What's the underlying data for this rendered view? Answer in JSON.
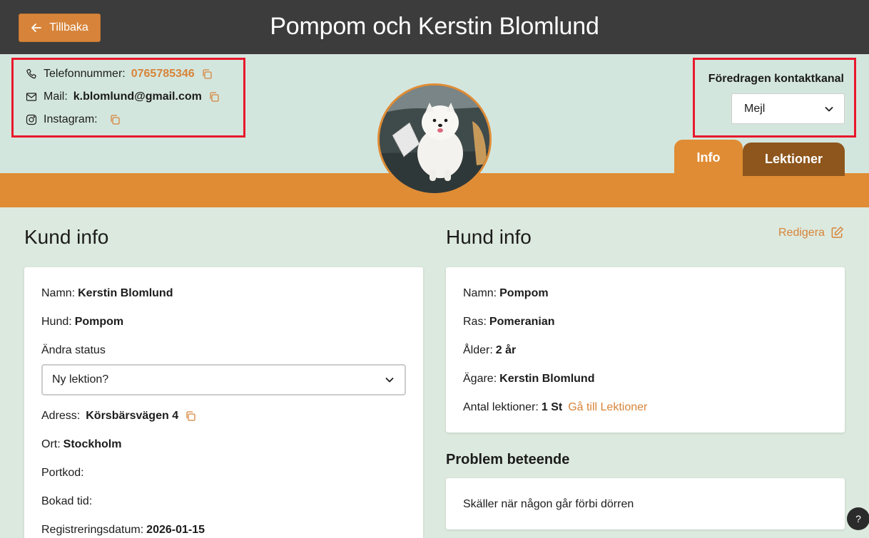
{
  "header": {
    "back_label": "Tillbaka",
    "title": "Pompom och Kerstin Blomlund"
  },
  "contact": {
    "phone_label": "Telefonnummer:",
    "phone_value": "0765785346",
    "mail_label": "Mail:",
    "mail_value": "k.blomlund@gmail.com",
    "instagram_label": "Instagram:"
  },
  "preferred_contact": {
    "label": "Föredragen kontaktkanal",
    "selected": "Mejl"
  },
  "tabs": [
    {
      "label": "Info"
    },
    {
      "label": "Lektioner"
    }
  ],
  "customer": {
    "section_title": "Kund info",
    "name_label": "Namn:",
    "name_value": "Kerstin Blomlund",
    "dog_label": "Hund:",
    "dog_value": "Pompom",
    "status_label": "Ändra status",
    "status_selected": "Ny lektion?",
    "address_label": "Adress:",
    "address_value": "Körsbärsvägen 4",
    "city_label": "Ort:",
    "city_value": "Stockholm",
    "doorcode_label": "Portkod:",
    "booked_label": "Bokad tid:",
    "registered_label": "Registreringsdatum:",
    "registered_value": "2026-01-15"
  },
  "dog": {
    "section_title": "Hund info",
    "edit_label": "Redigera",
    "name_label": "Namn:",
    "name_value": "Pompom",
    "breed_label": "Ras:",
    "breed_value": "Pomeranian",
    "age_label": "Ålder:",
    "age_value": "2 år",
    "owner_label": "Ägare:",
    "owner_value": "Kerstin Blomlund",
    "lessons_label": "Antal lektioner:",
    "lessons_value": "1 St",
    "lessons_link": "Gå till Lektioner"
  },
  "problem": {
    "title": "Problem beteende",
    "text": "Skäller när någon går förbi dörren"
  },
  "help": {
    "label": "?"
  },
  "colors": {
    "accent": "#d7843a",
    "band": "#e08c34",
    "dark_tab": "#8e561c",
    "topbar": "#3c3c3c",
    "highlight_border": "#e8182c"
  }
}
